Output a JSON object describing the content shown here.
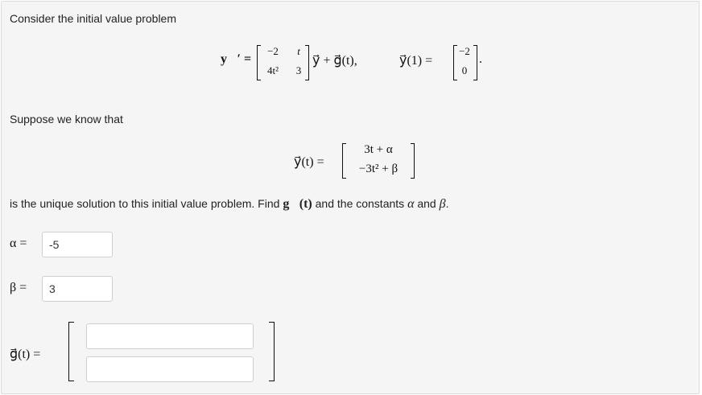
{
  "intro_text": "Consider the initial value problem",
  "ode": {
    "lhs": "y⃗′ =",
    "matrix": [
      [
        "−2",
        "t"
      ],
      [
        "4t²",
        "3"
      ]
    ],
    "rhs": "y⃗ + g⃗(t),",
    "ic_lhs": "y⃗(1) =",
    "ic_vector": [
      "−2",
      "0"
    ],
    "ic_end": "."
  },
  "suppose_text": "Suppose we know that",
  "solution": {
    "lhs": "y⃗(t) =",
    "components": [
      "3t + α",
      "−3t² + β"
    ]
  },
  "task": {
    "prefix": "is the unique solution to this initial value problem. Find ",
    "g": "g⃗(t)",
    "middle": " and the constants ",
    "alpha": "α",
    "and": " and ",
    "beta": "β",
    "end": "."
  },
  "answers": {
    "alpha_label": "α =",
    "alpha_value": "-5",
    "beta_label": "β =",
    "beta_value": "3",
    "g_label": "g⃗(t) =",
    "g_row1": "",
    "g_row2": ""
  }
}
